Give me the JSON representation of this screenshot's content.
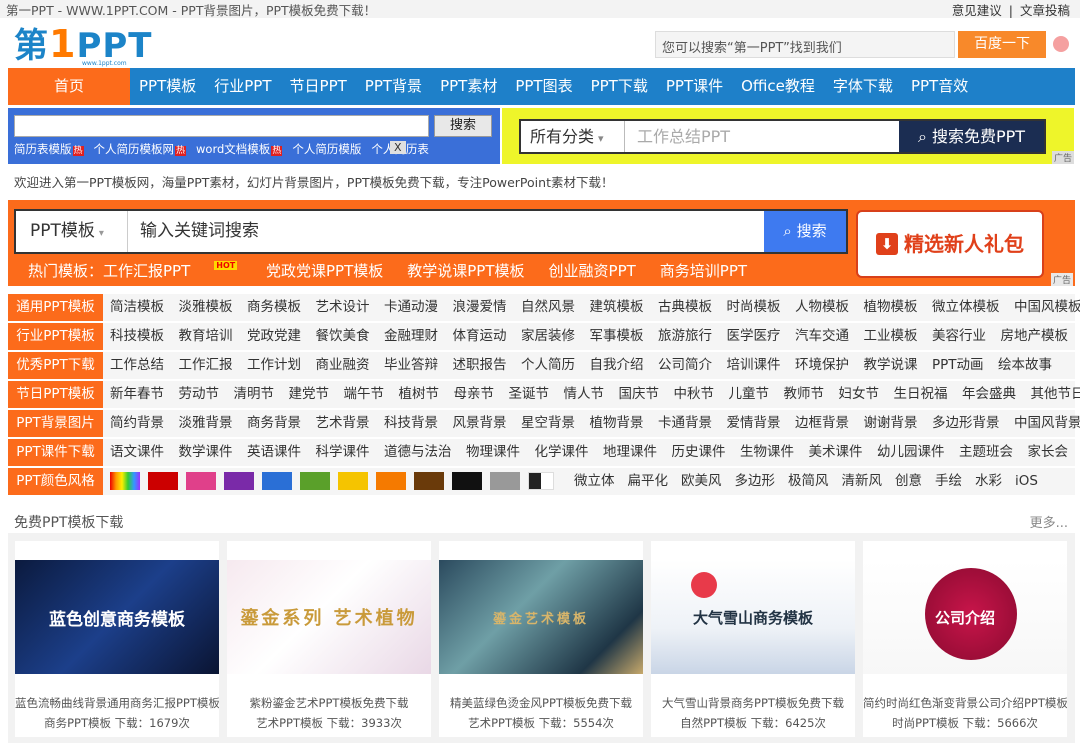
{
  "topbar": {
    "title": "第一PPT - WWW.1PPT.COM - PPT背景图片，PPT模板免费下载！",
    "links": [
      "意见建议",
      "文章投稿"
    ],
    "sep": "|"
  },
  "logo": {
    "text": "第",
    "num": "1",
    "ppt": "PPT",
    "url": "www.1ppt.com"
  },
  "topsearch": {
    "placeholder": "您可以搜索“第一PPT”找到我们",
    "button": "百度一下"
  },
  "nav": {
    "home": "首页",
    "items": [
      "PPT模板",
      "行业PPT",
      "节日PPT",
      "PPT背景",
      "PPT素材",
      "PPT图表",
      "PPT下载",
      "PPT课件",
      "Office教程",
      "字体下载",
      "PPT音效"
    ]
  },
  "search1": {
    "button": "搜索",
    "links": [
      "简历表模版",
      "个人简历模板网",
      "word文档模板",
      "个人简历模版",
      "个人简历表"
    ],
    "hot": "热",
    "close": "X"
  },
  "search2": {
    "category": "所有分类",
    "caret": "▾",
    "placeholder": "工作总结PPT",
    "button": "搜索免费PPT",
    "ad": "广告"
  },
  "welcome": "欢迎进入第一PPT模板网，海量PPT素材，幻灯片背景图片，PPT模板免费下载，专注PowerPoint素材下载！",
  "hero": {
    "category": "PPT模板",
    "caret": "▾",
    "placeholder": "输入关键词搜索",
    "button": "搜索",
    "hot_prefix": "热门模板：工作汇报PPT",
    "hot_badge": "HOT",
    "hot": [
      "党政党课PPT模板",
      "教学说课PPT模板",
      "创业融资PPT",
      "商务培训PPT"
    ],
    "gift": "精选新人礼包",
    "gift_icon": "⬇",
    "ad": "广告"
  },
  "categories": [
    {
      "label": "通用PPT模板",
      "items": [
        "简洁模板",
        "淡雅模板",
        "商务模板",
        "艺术设计",
        "卡通动漫",
        "浪漫爱情",
        "自然风景",
        "建筑模板",
        "古典模板",
        "时尚模板",
        "人物模板",
        "植物模板",
        "微立体模板",
        "中国风模板"
      ]
    },
    {
      "label": "行业PPT模板",
      "items": [
        "科技模板",
        "教育培训",
        "党政党建",
        "餐饮美食",
        "金融理财",
        "体育运动",
        "家居装修",
        "军事模板",
        "旅游旅行",
        "医学医疗",
        "汽车交通",
        "工业模板",
        "美容行业",
        "房地产模板"
      ]
    },
    {
      "label": "优秀PPT下载",
      "items": [
        "工作总结",
        "工作汇报",
        "工作计划",
        "商业融资",
        "毕业答辩",
        "述职报告",
        "个人简历",
        "自我介绍",
        "公司简介",
        "培训课件",
        "环境保护",
        "教学说课",
        "PPT动画",
        "绘本故事"
      ]
    },
    {
      "label": "节日PPT模板",
      "items": [
        "新年春节",
        "劳动节",
        "清明节",
        "建党节",
        "端午节",
        "植树节",
        "母亲节",
        "圣诞节",
        "情人节",
        "国庆节",
        "中秋节",
        "儿童节",
        "教师节",
        "妇女节",
        "生日祝福",
        "年会盛典",
        "其他节日"
      ]
    },
    {
      "label": "PPT背景图片",
      "items": [
        "简约背景",
        "淡雅背景",
        "商务背景",
        "艺术背景",
        "科技背景",
        "风景背景",
        "星空背景",
        "植物背景",
        "卡通背景",
        "爱情背景",
        "边框背景",
        "谢谢背景",
        "多边形背景",
        "中国风背景"
      ]
    },
    {
      "label": "PPT课件下载",
      "items": [
        "语文课件",
        "数学课件",
        "英语课件",
        "科学课件",
        "道德与法治",
        "物理课件",
        "化学课件",
        "地理课件",
        "历史课件",
        "生物课件",
        "美术课件",
        "幼儿园课件",
        "主题班会",
        "家长会"
      ]
    }
  ],
  "colors": {
    "label": "PPT颜色风格",
    "swatches": [
      "#cc0000",
      "#e0408a",
      "#7a2aa8",
      "#2a6fd6",
      "#5aa02a",
      "#f5c400",
      "#f57a00",
      "#6a3a0a",
      "#111111",
      "#999999"
    ],
    "styles": [
      "微立体",
      "扁平化",
      "欧美风",
      "多边形",
      "极简风",
      "清新风",
      "创意",
      "手绘",
      "水彩",
      "iOS"
    ]
  },
  "free": {
    "title": "免费PPT模板下载",
    "more": "更多..."
  },
  "cards": [
    {
      "img_text": "蓝色创意商务模板",
      "title": "蓝色流畅曲线背景通用商务汇报PPT模板",
      "meta": "商务PPT模板  下载：1679次"
    },
    {
      "img_text": "鎏金系列 艺术植物",
      "title": "紫粉鎏金艺术PPT模板免费下载",
      "meta": "艺术PPT模板  下载：3933次"
    },
    {
      "img_text": "鎏金艺术模板",
      "title": "精美蓝绿色烫金风PPT模板免费下载",
      "meta": "艺术PPT模板  下载：5554次"
    },
    {
      "img_text": "大气雪山商务模板",
      "title": "大气雪山背景商务PPT模板免费下载",
      "meta": "自然PPT模板  下载：6425次"
    },
    {
      "img_text": "公司介绍",
      "title": "简约时尚红色渐变背景公司介绍PPT模板",
      "meta": "时尚PPT模板  下载：5666次"
    }
  ]
}
